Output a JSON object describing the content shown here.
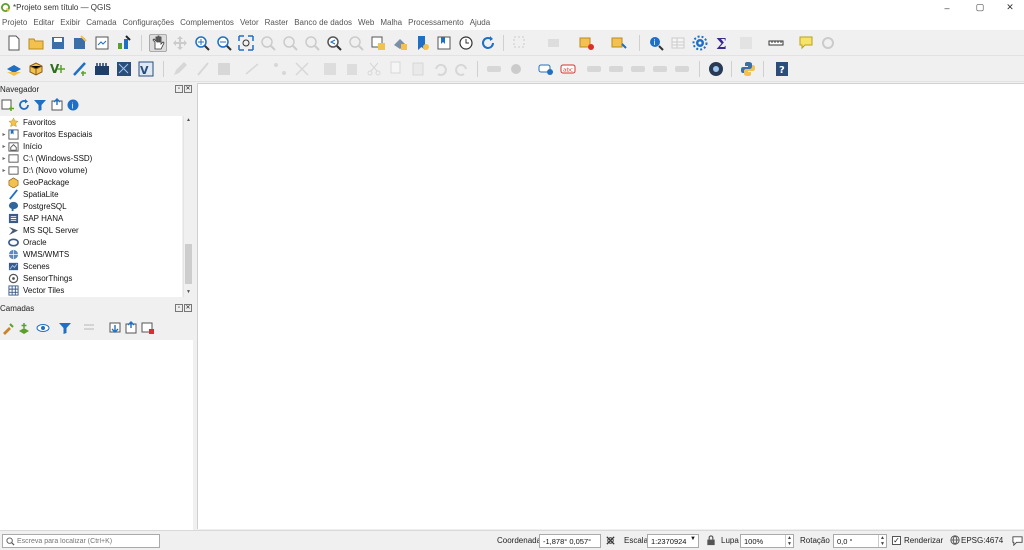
{
  "window": {
    "title": "*Projeto sem título — QGIS",
    "controls": {
      "minimize": "–",
      "maximize": "▢",
      "close": "✕"
    }
  },
  "menu": [
    "Projeto",
    "Editar",
    "Exibir",
    "Camada",
    "Configurações",
    "Complementos",
    "Vetor",
    "Raster",
    "Banco de dados",
    "Web",
    "Malha",
    "Processamento",
    "Ajuda"
  ],
  "toolbar_row1": [
    "new-project-icon",
    "open-project-icon",
    "save-project-icon",
    "save-as-icon",
    "print-layout-icon",
    "style-manager-icon",
    "pan-map-icon",
    "pan-to-selection-icon",
    "zoom-in-icon",
    "zoom-out-icon",
    "zoom-full-icon",
    "zoom-selection-icon",
    "zoom-layer-icon",
    "zoom-native-icon",
    "zoom-last-icon",
    "zoom-next-icon",
    "new-map-view-icon",
    "new-3d-view-icon",
    "new-bookmark-icon",
    "show-bookmarks-icon",
    "temporal-icon",
    "refresh-icon",
    "select-feature-icon",
    "select-by-value-icon",
    "deselect-icon",
    "select-location-icon",
    "identify-icon",
    "open-attribute-table-icon",
    "processing-toolbox-icon",
    "statistics-icon",
    "attribute-calculator-icon",
    "measure-icon",
    "annotation-icon",
    "locate-icon"
  ],
  "toolbar_row2": [
    "add-layer-icon",
    "geopackage-icon",
    "new-vector-icon",
    "new-spatialite-icon",
    "new-temp-layer-icon",
    "new-virtual-layer-icon",
    "add-wms-icon",
    "edit-pencil-icon",
    "toggle-editing-icon",
    "save-edits-icon",
    "digitize-icon",
    "add-vertex-icon",
    "vertex-tool-icon",
    "attribute-edit-icon",
    "delete-selected-icon",
    "cut-icon",
    "copy-icon",
    "paste-icon",
    "undo-icon",
    "redo-icon",
    "label-icon",
    "label-pin-icon",
    "label-highlight-icon",
    "label-abc-icon",
    "label-move-icon",
    "label-rotate-icon",
    "label-change-icon",
    "label-show-icon",
    "label-hide-icon",
    "gps-icon",
    "python-icon",
    "help-icon"
  ],
  "navigator": {
    "title": "Navegador",
    "items": [
      {
        "label": "Favoritos",
        "icon": "star-icon",
        "arrow": ""
      },
      {
        "label": "Favoritos Espaciais",
        "icon": "spatial-bookmark-icon",
        "arrow": "▸"
      },
      {
        "label": "Início",
        "icon": "home-folder-icon",
        "arrow": "▸"
      },
      {
        "label": "C:\\ (Windows-SSD)",
        "icon": "drive-icon",
        "arrow": "▸"
      },
      {
        "label": "D:\\ (Novo volume)",
        "icon": "drive-icon",
        "arrow": "▸"
      },
      {
        "label": "GeoPackage",
        "icon": "geopackage-icon",
        "arrow": ""
      },
      {
        "label": "SpatiaLite",
        "icon": "spatialite-icon",
        "arrow": ""
      },
      {
        "label": "PostgreSQL",
        "icon": "postgresql-icon",
        "arrow": ""
      },
      {
        "label": "SAP HANA",
        "icon": "sap-hana-icon",
        "arrow": ""
      },
      {
        "label": "MS SQL Server",
        "icon": "mssql-icon",
        "arrow": ""
      },
      {
        "label": "Oracle",
        "icon": "oracle-icon",
        "arrow": ""
      },
      {
        "label": "WMS/WMTS",
        "icon": "wms-icon",
        "arrow": ""
      },
      {
        "label": "Scenes",
        "icon": "scenes-icon",
        "arrow": ""
      },
      {
        "label": "SensorThings",
        "icon": "sensorthings-icon",
        "arrow": ""
      },
      {
        "label": "Vector Tiles",
        "icon": "vector-tiles-icon",
        "arrow": ""
      }
    ]
  },
  "layers": {
    "title": "Camadas"
  },
  "status": {
    "locator_placeholder": "Escreva para localizar (Ctrl+K)",
    "coord_label": "Coordenada",
    "coord_value": "-1,878° 0,057°",
    "scale_label": "Escala",
    "scale_value": "1:2370924",
    "magnifier_label": "Lupa",
    "magnifier_value": "100%",
    "rotation_label": "Rotação",
    "rotation_value": "0,0 °",
    "render_label": "Renderizar",
    "render_checked": "✓",
    "crs": "EPSG:4674"
  },
  "colors": {
    "accent_blue": "#1f6fc4",
    "folder_yellow": "#f2c14e",
    "qgis_green": "#5aa02c"
  }
}
